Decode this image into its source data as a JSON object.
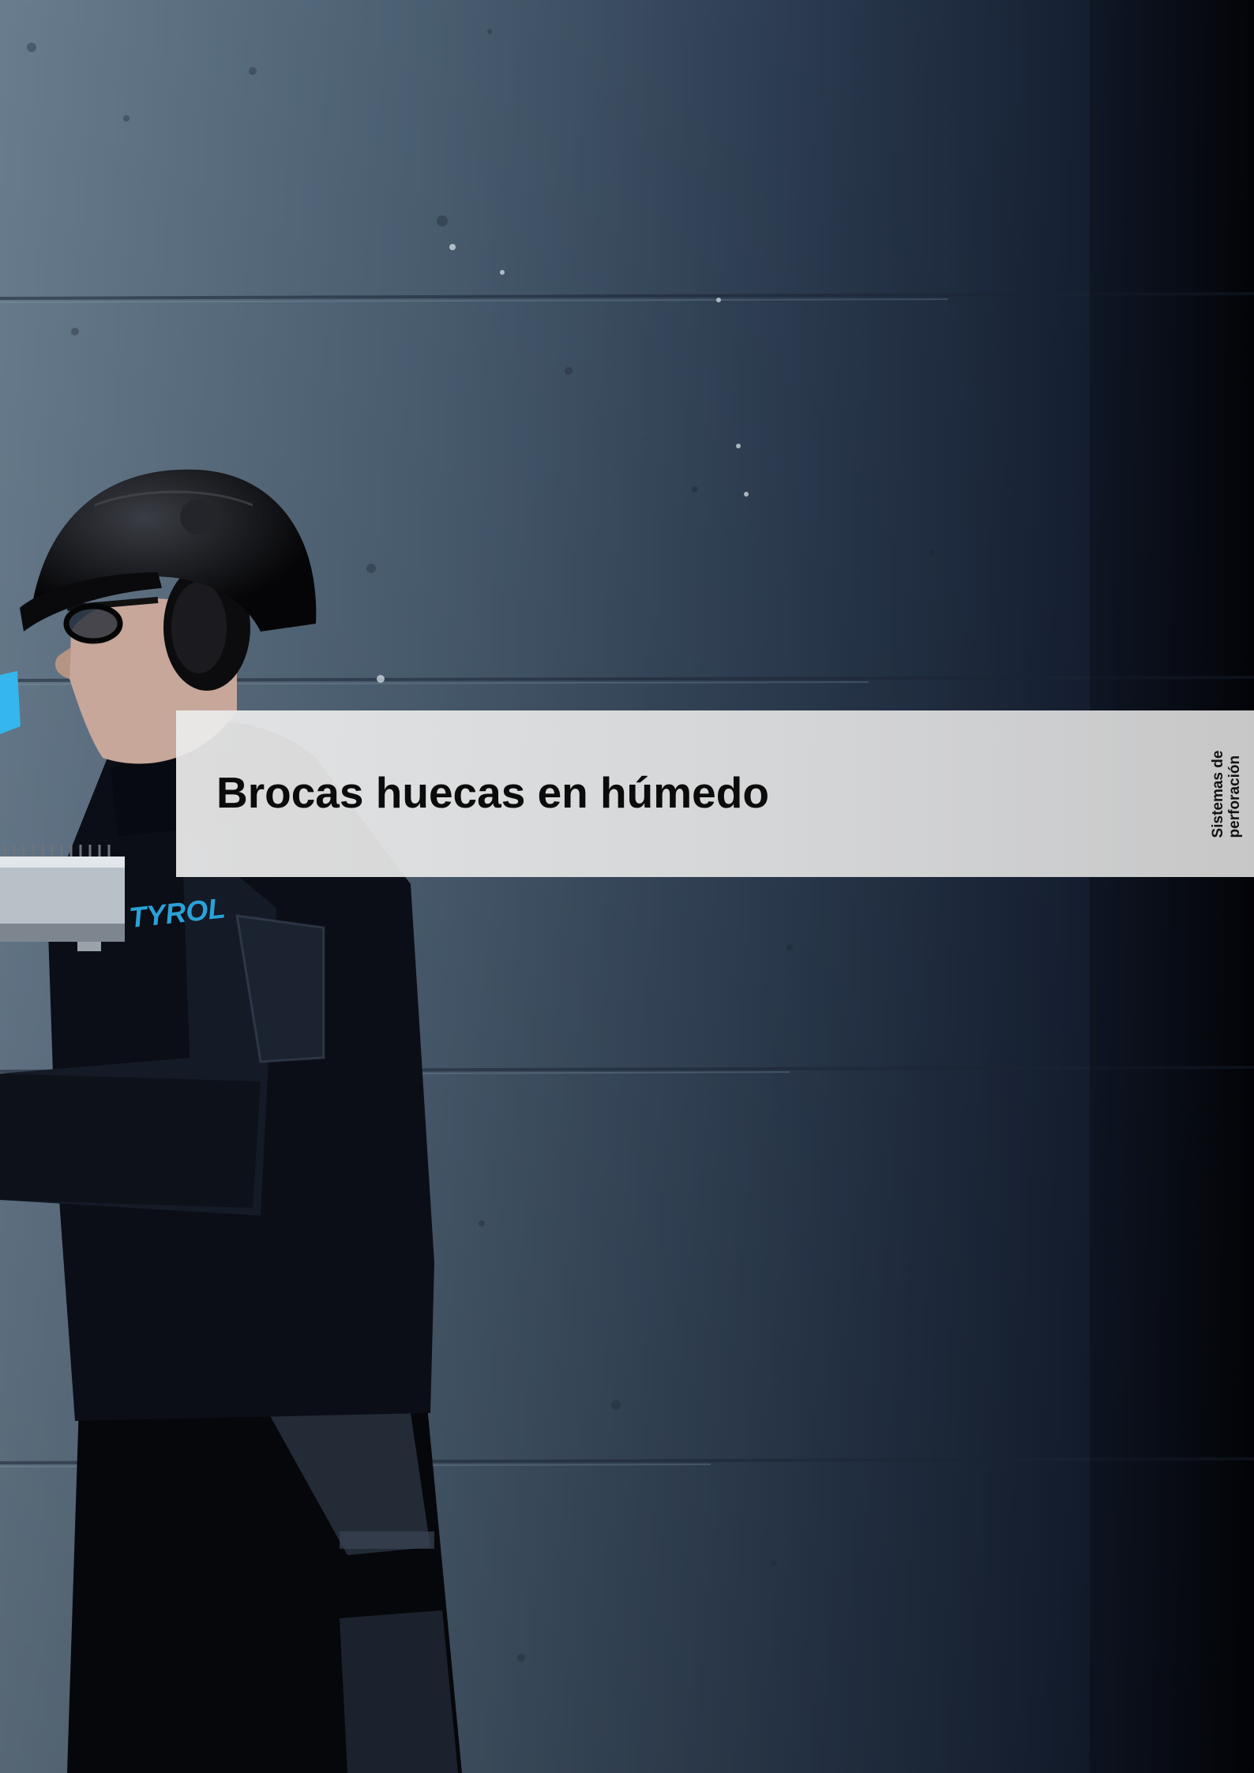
{
  "page": {
    "title": "Brocas huecas en húmedo",
    "section_tab": {
      "line1": "Sistemas de",
      "line2": "perforación"
    },
    "photo": {
      "description_icon": "worker-with-core-drill-photo",
      "jacket_logo_text": "TYROL"
    }
  },
  "colors": {
    "title_band": "#e6e6e6",
    "title_text": "#0b0b0b",
    "background_dark": "#05070d",
    "background_concrete": "#5f7488",
    "accent_blue": "#2aa2d8"
  }
}
